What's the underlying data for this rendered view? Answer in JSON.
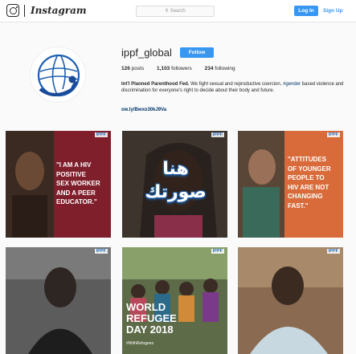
{
  "nav": {
    "wordmark": "Instagram",
    "search_placeholder": "Search",
    "login_label": "Log In",
    "signup_label": "Sign Up"
  },
  "profile": {
    "username": "ippf_global",
    "follow_label": "Follow",
    "posts_count": "126",
    "posts_label": "posts",
    "followers_count": "1,103",
    "followers_label": "followers",
    "following_count": "234",
    "following_label": "following",
    "full_name": "Int'l Planned Parenthood Fed.",
    "bio_text": "We fight sexual and reproductive coercion,",
    "bio_hashtag": "#gender",
    "bio_rest": "based violence and discrimination for everyone's right to decide about their body and future.",
    "link": "ow.ly/Bwxo30kJ9Va"
  },
  "posts": [
    {
      "logo": "IPPF",
      "lines": [
        "\"I AM A HIV",
        "POSITIVE",
        "SEX WORKER",
        "AND A PEER",
        "EDUCATOR.\""
      ]
    },
    {
      "logo": "IPPF"
    },
    {
      "logo": "IPPF",
      "lines": [
        "\"ATTITUDES",
        "OF YOUNGER",
        "PEOPLE TO",
        "HIV ARE NOT",
        "CHANGING",
        "FAST.\""
      ]
    },
    {
      "logo": "IPPF"
    },
    {
      "logo": "IPPF",
      "lines": [
        "WORLD",
        "REFUGEE",
        "DAY 2018"
      ],
      "hashtag": "#WithRefugees"
    },
    {
      "logo": "IPPF"
    }
  ],
  "overlay": {
    "line1": "هنا",
    "line2": "صورتك"
  },
  "colors": {
    "accent_blue": "#3897f0",
    "link_blue": "#003569",
    "ippf_blue": "#2a6fb8"
  }
}
